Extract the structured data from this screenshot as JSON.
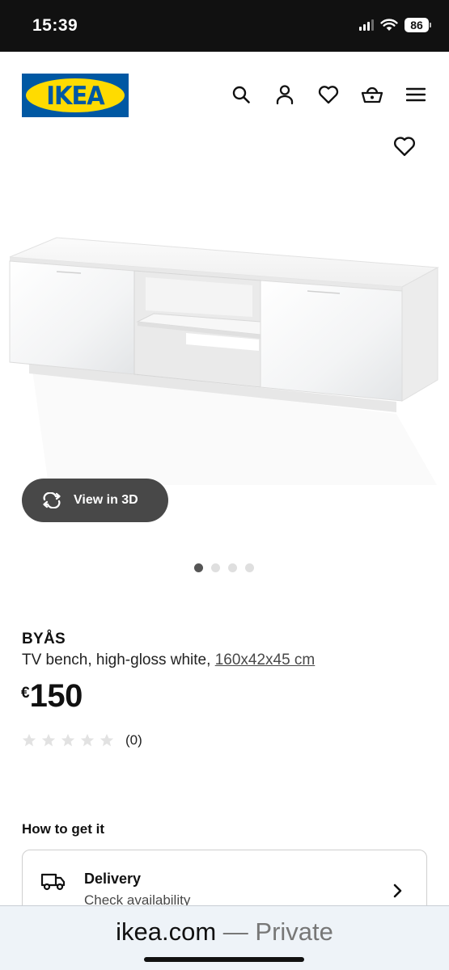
{
  "status_bar": {
    "time": "15:39",
    "battery": "86",
    "icons": [
      "cellular-signal-icon",
      "wifi-icon",
      "battery-icon"
    ]
  },
  "header": {
    "logo_text": "IKEA",
    "icons": [
      "search-icon",
      "account-icon",
      "favorites-heart-icon",
      "shopping-basket-icon",
      "menu-icon"
    ]
  },
  "gallery": {
    "view_3d_label": "View in 3D",
    "total_images": 4,
    "active_index": 0
  },
  "product": {
    "name": "BYÅS",
    "description": "TV bench, high-gloss white,",
    "measurement": "160x42x45 cm",
    "price_currency": "€",
    "price_value": "150",
    "rating_stars": 0,
    "rating_max": 5,
    "review_count": "(0)"
  },
  "fulfilment": {
    "title": "How to get it",
    "delivery_label": "Delivery",
    "delivery_sub": "Check availability"
  },
  "browser": {
    "domain": "ikea.com",
    "mode": "— Private"
  },
  "colors": {
    "ikea_blue": "#0058a3",
    "ikea_yellow": "#ffdb00",
    "dark_button": "#484848"
  }
}
